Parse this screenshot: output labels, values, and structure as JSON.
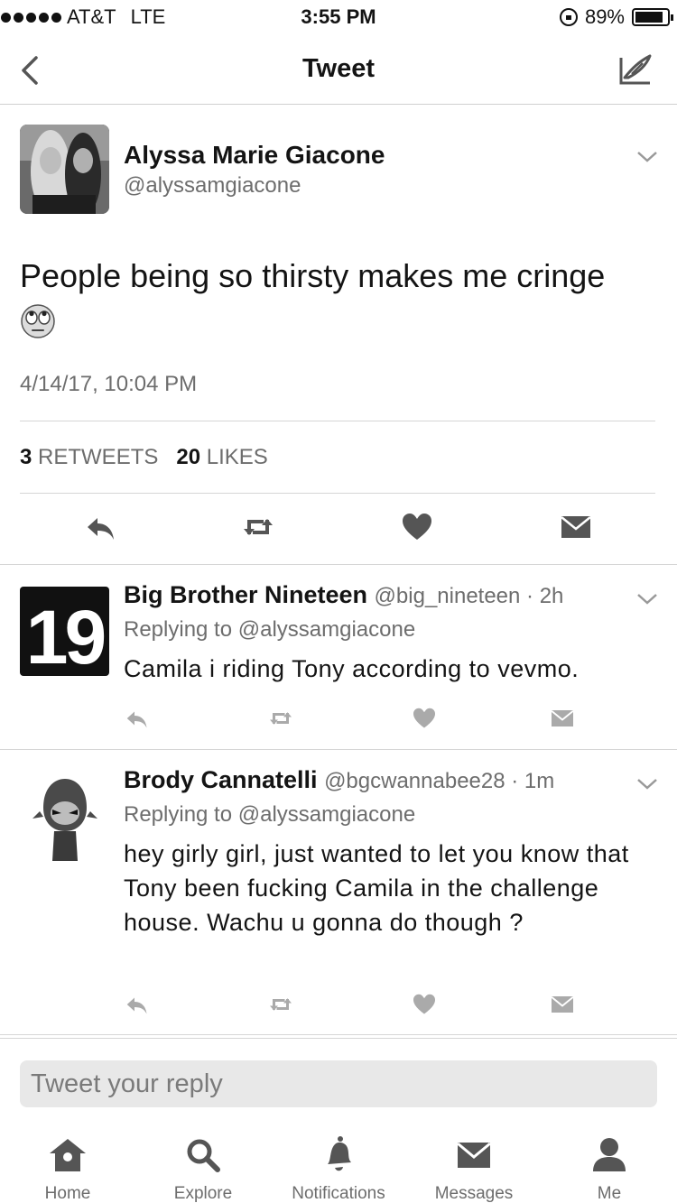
{
  "status_bar": {
    "carrier": "AT&T",
    "network": "LTE",
    "time": "3:55 PM",
    "battery_percent": "89%",
    "battery_level": 0.89
  },
  "nav": {
    "title": "Tweet",
    "back_icon": "chevron-left-icon",
    "compose_icon": "compose-tweet-icon"
  },
  "main_tweet": {
    "author_name": "Alyssa Marie Giacone",
    "author_handle": "@alyssamgiacone",
    "text": "People being so thirsty makes me cringe",
    "emoji": "face-with-rolling-eyes",
    "timestamp": "4/14/17, 10:04 PM",
    "retweets_count": "3",
    "retweets_label": "RETWEETS",
    "likes_count": "20",
    "likes_label": "LIKES"
  },
  "replies": [
    {
      "author_name": "Big Brother Nineteen",
      "author_handle": "@big_nineteen · 2h",
      "avatar_text": "19",
      "replying_to": "Replying to @alyssamgiacone",
      "text": "Camila i riding Tony according to vevmo."
    },
    {
      "author_name": "Brody Cannatelli",
      "author_handle": "@bgcwannabee28 · 1m",
      "replying_to": "Replying to @alyssamgiacone",
      "text": "hey girly girl, just wanted to let you know that Tony been fucking Camila in the challenge house. Wachu u gonna do though ?"
    }
  ],
  "reply_box": {
    "placeholder": "Tweet your reply"
  },
  "tab_bar": [
    {
      "label": "Home",
      "icon": "home-icon"
    },
    {
      "label": "Explore",
      "icon": "search-icon"
    },
    {
      "label": "Notifications",
      "icon": "bell-icon"
    },
    {
      "label": "Messages",
      "icon": "envelope-icon"
    },
    {
      "label": "Me",
      "icon": "person-icon"
    }
  ]
}
